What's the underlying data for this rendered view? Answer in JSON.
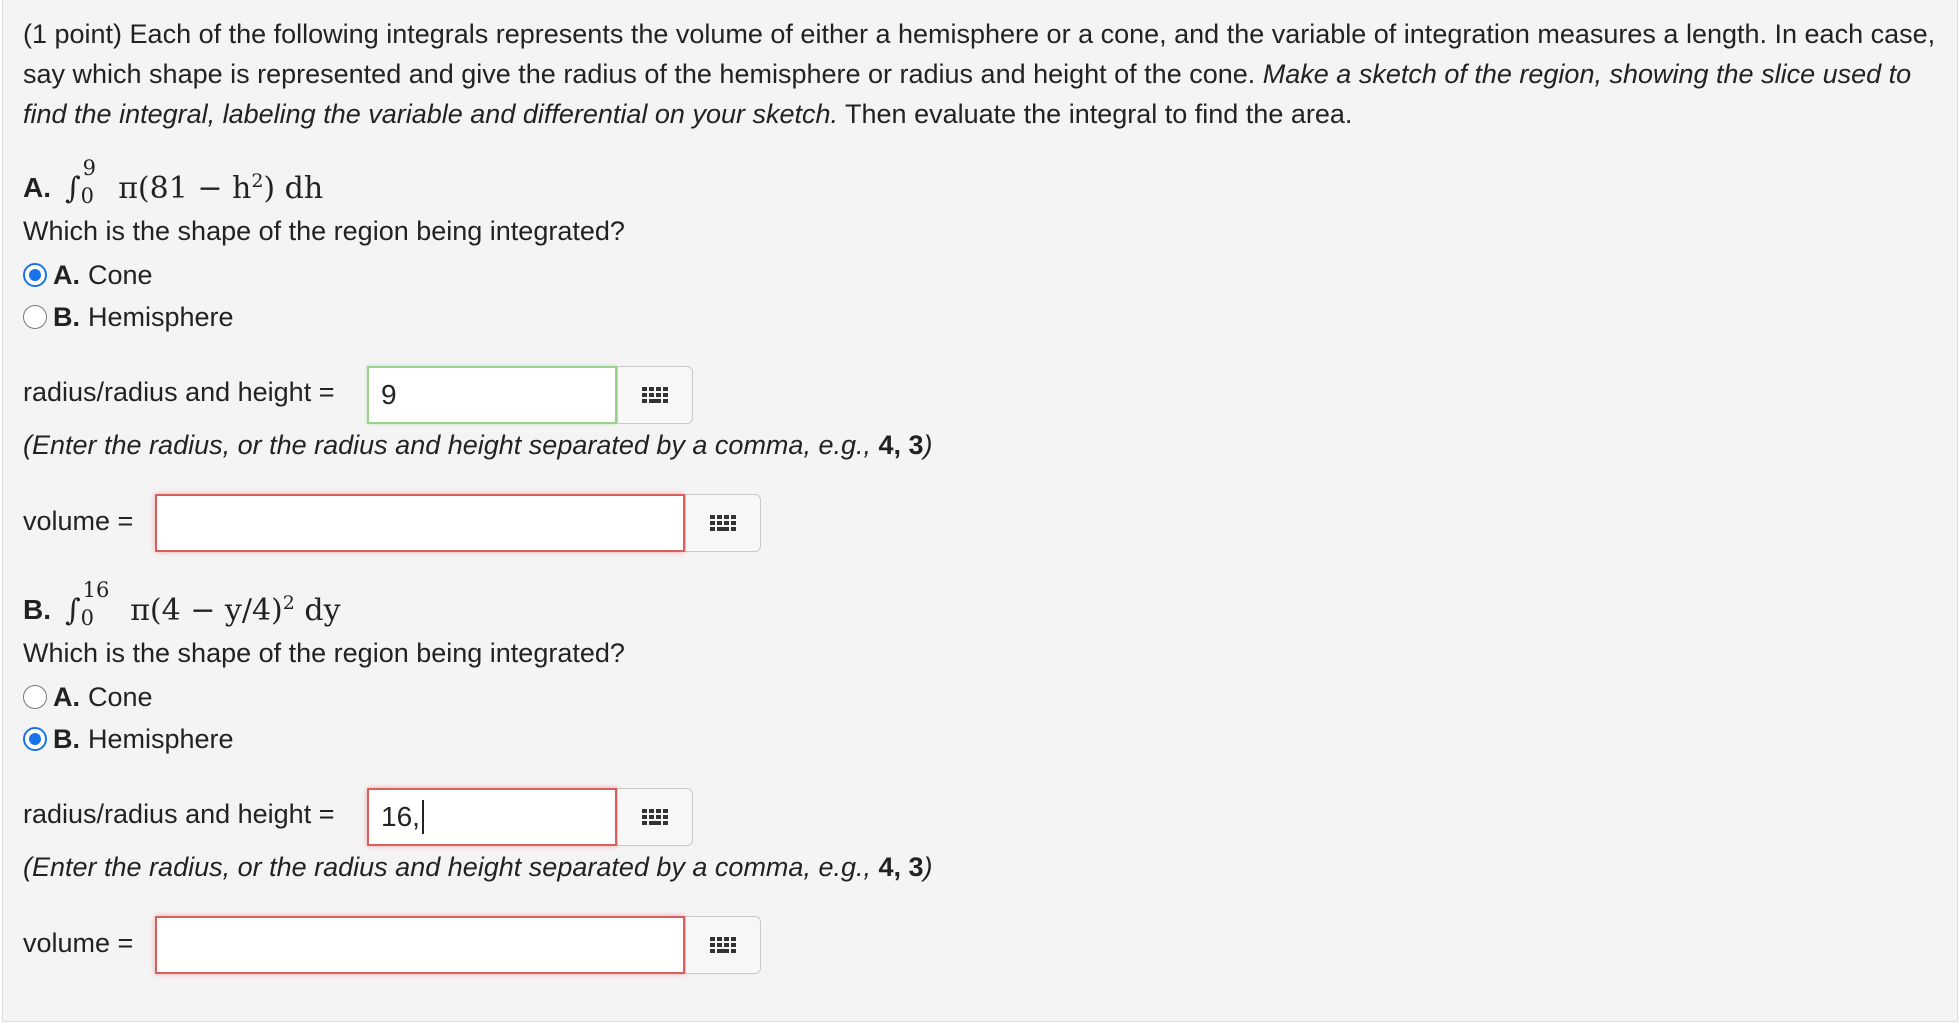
{
  "intro": {
    "text_start": "(1 point) Each of the following integrals represents the volume of either a hemisphere or a cone, and the variable of integration measures a length. In each case, say which shape is represented and give the radius of the hemisphere or radius and height of the cone. ",
    "text_italic": "Make a sketch of the region, showing the slice used to find the integral, labeling the variable and differential on your sketch.",
    "text_end": " Then evaluate the integral to find the area."
  },
  "partA": {
    "label": "A.",
    "upper": "9",
    "lower": "0",
    "integrand": "π(81 − h",
    "exp": "2",
    "integrand_end": ") dh",
    "question": "Which is the shape of the region being integrated?",
    "options": [
      {
        "key": "A.",
        "label": "Cone",
        "checked": true
      },
      {
        "key": "B.",
        "label": "Hemisphere",
        "checked": false
      }
    ],
    "radius_label": "radius/radius and height =",
    "radius_value": "9",
    "hint_text": "(Enter the radius, or the radius and height separated by a comma, e.g., ",
    "hint_example": "4, 3",
    "hint_close": ")",
    "volume_label": "volume =",
    "volume_value": ""
  },
  "partB": {
    "label": "B.",
    "upper": "16",
    "lower": "0",
    "integrand": "π(4 − y/4)",
    "exp": "2",
    "integrand_end": " dy",
    "question": "Which is the shape of the region being integrated?",
    "options": [
      {
        "key": "A.",
        "label": "Cone",
        "checked": false
      },
      {
        "key": "B.",
        "label": "Hemisphere",
        "checked": true
      }
    ],
    "radius_label": "radius/radius and height =",
    "radius_value": "16,",
    "hint_text": "(Enter the radius, or the radius and height separated by a comma, e.g., ",
    "hint_example": "4, 3",
    "hint_close": ")",
    "volume_label": "volume =",
    "volume_value": ""
  },
  "colors": {
    "accent": "#1a73e8",
    "valid_border": "#9ad18d",
    "error_border": "#d95f5f",
    "panel_bg": "#f4f4f4"
  },
  "icons": {
    "keyboard": "keyboard-grid-icon"
  }
}
